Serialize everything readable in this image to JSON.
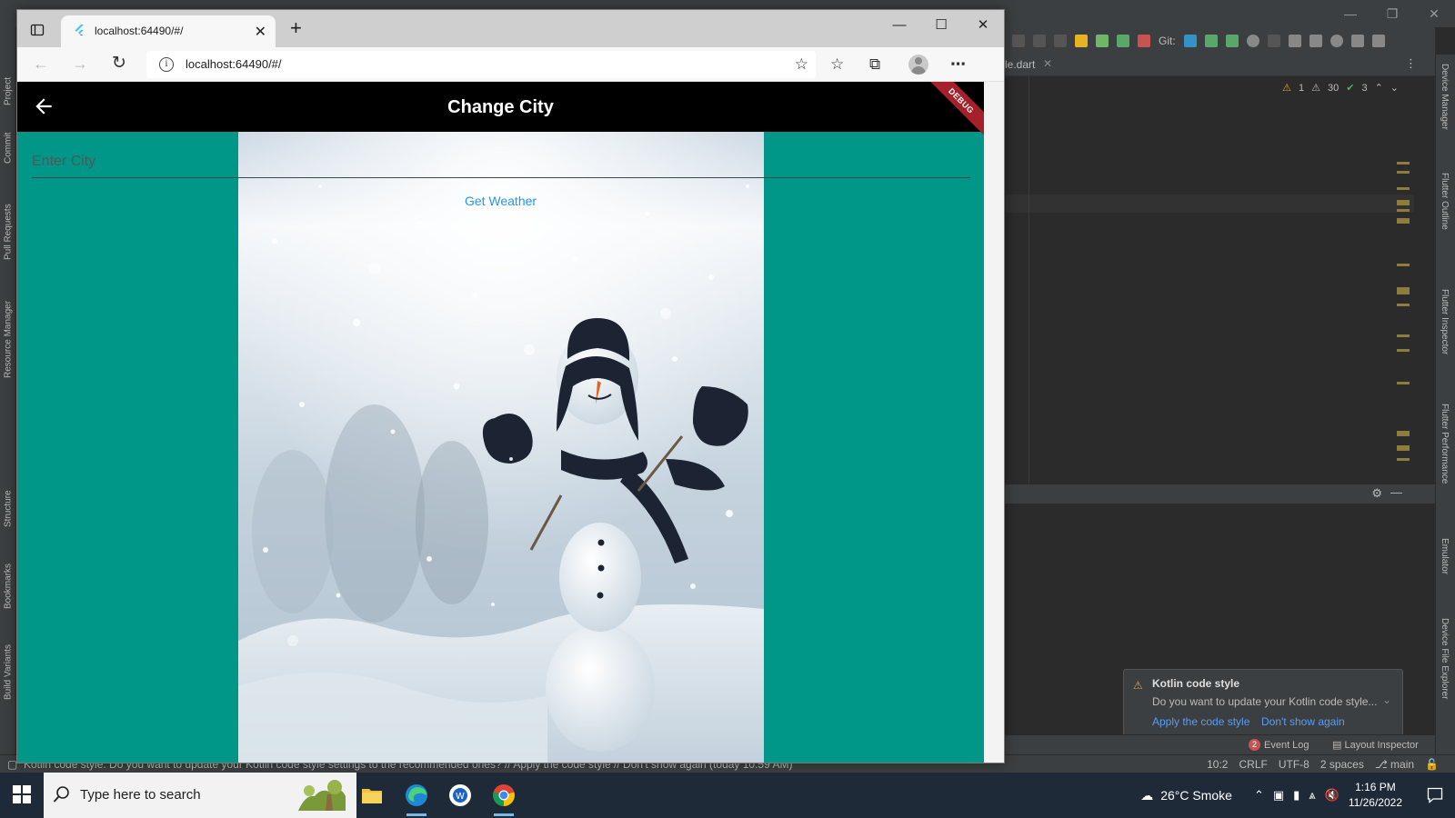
{
  "browser": {
    "tab_title": "localhost:64490/#/",
    "url": "localhost:64490/#/"
  },
  "app": {
    "title": "Change City",
    "debug_banner": "DEBUG",
    "city_placeholder": "Enter City",
    "city_value": "",
    "get_weather_label": "Get Weather",
    "background_color": "#009688",
    "appbar_color": "#000000",
    "accent_color": "#2196F3"
  },
  "ide": {
    "editor_tab": "le.dart",
    "git_label": "Git:",
    "inspection": {
      "warn_a": "1",
      "warn_b": "30",
      "ok": "3"
    },
    "left_tool_windows": [
      "Project",
      "Commit",
      "Pull Requests",
      "Resource Manager",
      "Structure",
      "Bookmarks",
      "Build Variants"
    ],
    "right_tool_windows": [
      "Device Manager",
      "Flutter Outline",
      "Flutter Inspector",
      "Flutter Performance",
      "Emulator",
      "Device File Explorer"
    ],
    "notification": {
      "title": "Kotlin code style",
      "body": "Do you want to update your Kotlin code style...",
      "apply": "Apply the code style",
      "dismiss": "Don't show again"
    },
    "bottom_tools": {
      "event_log_count": "2",
      "event_log": "Event Log",
      "layout_inspector": "Layout Inspector"
    },
    "status_bar": {
      "message": "Kotlin code style: Do you want to update your Kotlin code style settings to the recommended ones? // Apply the code style // Don't show again (today 10:59 AM)",
      "position": "10:2",
      "line_sep": "CRLF",
      "encoding": "UTF-8",
      "indent": "2 spaces",
      "branch": "main"
    }
  },
  "taskbar": {
    "search_placeholder": "Type here to search",
    "weather": "26°C  Smoke",
    "time": "1:16 PM",
    "date": "11/26/2022"
  }
}
